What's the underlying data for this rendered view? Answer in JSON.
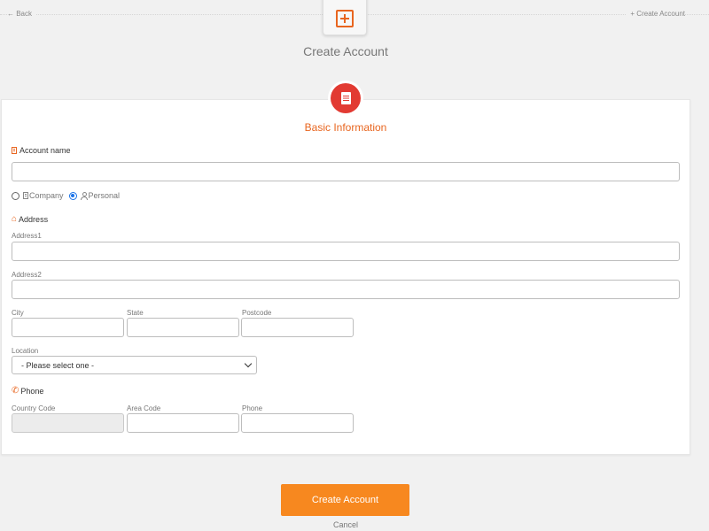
{
  "topbar": {
    "back_label": "← Back",
    "create_label": "+ Create Account",
    "icon": "plus-square-icon"
  },
  "header": {
    "title": "Create Account"
  },
  "section": {
    "title": "Basic Information",
    "icon": "document-icon"
  },
  "account": {
    "label": "Account name",
    "value": "",
    "types": [
      {
        "label": "Company",
        "icon": "building-icon",
        "checked": false
      },
      {
        "label": "Personal",
        "icon": "user-icon",
        "checked": true
      }
    ]
  },
  "address": {
    "heading": "Address",
    "address1_label": "Address1",
    "address2_label": "Address2",
    "city_label": "City",
    "state_label": "State",
    "postcode_label": "Postcode",
    "location_label": "Location",
    "location_selected": "- Please select one -"
  },
  "phone": {
    "heading": "Phone",
    "country_code_label": "Country Code",
    "area_code_label": "Area Code",
    "phone_label": "Phone"
  },
  "actions": {
    "submit_label": "Create Account",
    "cancel_label": "Cancel"
  },
  "colors": {
    "accent": "#e8651f",
    "button": "#f7881f",
    "badge": "#e23a32",
    "radio_checked": "#1a73e8"
  }
}
